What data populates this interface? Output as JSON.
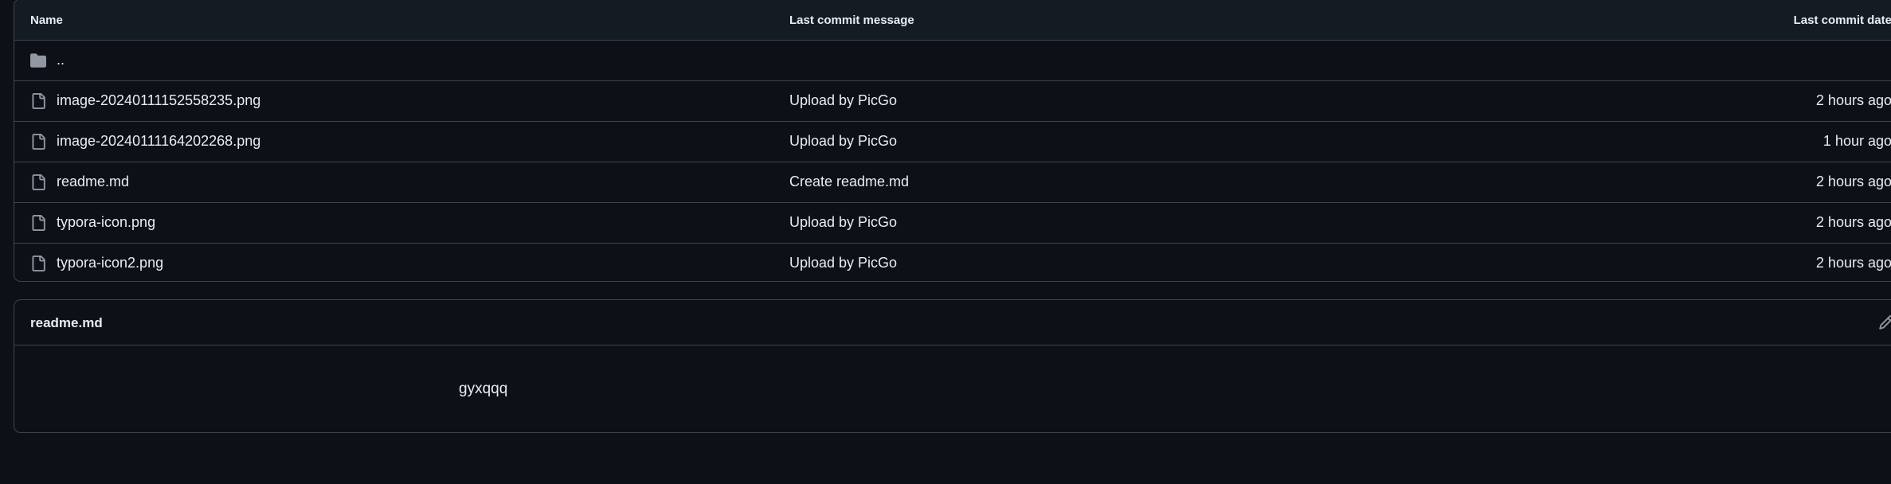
{
  "table": {
    "headers": {
      "name": "Name",
      "message": "Last commit message",
      "date": "Last commit date"
    },
    "parent_dir": "..",
    "files": [
      {
        "name": "image-20240111152558235.png",
        "message": "Upload by PicGo",
        "date": "2 hours ago"
      },
      {
        "name": "image-20240111164202268.png",
        "message": "Upload by PicGo",
        "date": "1 hour ago"
      },
      {
        "name": "readme.md",
        "message": "Create readme.md",
        "date": "2 hours ago"
      },
      {
        "name": "typora-icon.png",
        "message": "Upload by PicGo",
        "date": "2 hours ago"
      },
      {
        "name": "typora-icon2.png",
        "message": "Upload by PicGo",
        "date": "2 hours ago"
      }
    ]
  },
  "readme": {
    "title": "readme.md",
    "content": "gyxqqq"
  },
  "icons": {
    "parent": "folder-icon",
    "file": "file-icon",
    "edit": "pencil-icon"
  },
  "colors": {
    "background": "#0d1117",
    "header_bg": "#151b23",
    "border": "#3d444d",
    "text": "#e6edf3",
    "icon": "#9198a1"
  }
}
